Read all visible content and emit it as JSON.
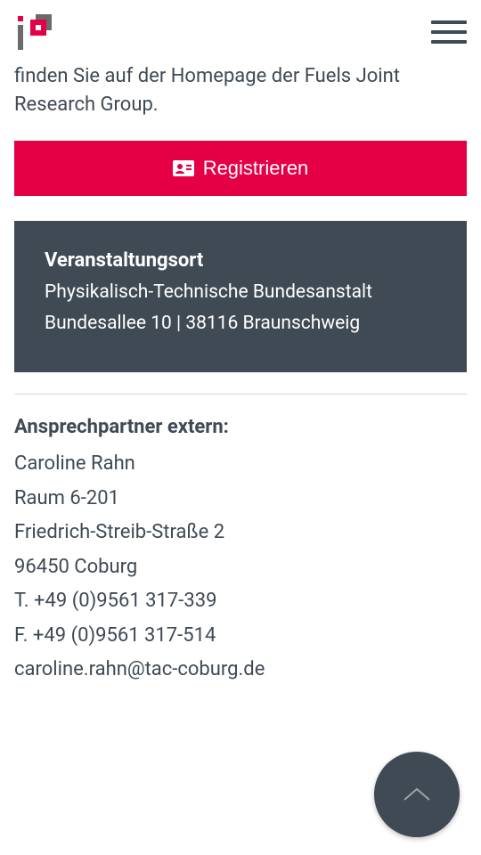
{
  "header": {
    "logo_alt": "iP3"
  },
  "intro_text": "finden Sie auf der Homepage der Fuels Joint Research Group.",
  "register": {
    "label": "Registrieren"
  },
  "venue": {
    "heading": "Veranstaltungsort",
    "name": "Physikalisch-Technische Bundesanstalt",
    "address": "Bundesallee 10 | 38116 Braunschweig"
  },
  "contact": {
    "heading": "Ansprechpartner extern:",
    "name": "Caroline Rahn",
    "room": "Raum 6-201",
    "street": "Friedrich-Streib-Straße 2",
    "city": "96450 Coburg",
    "tel": "T. +49 (0)9561 317-339",
    "fax": "F. +49 (0)9561 317-514",
    "email": "caroline.rahn@tac-coburg.de"
  }
}
